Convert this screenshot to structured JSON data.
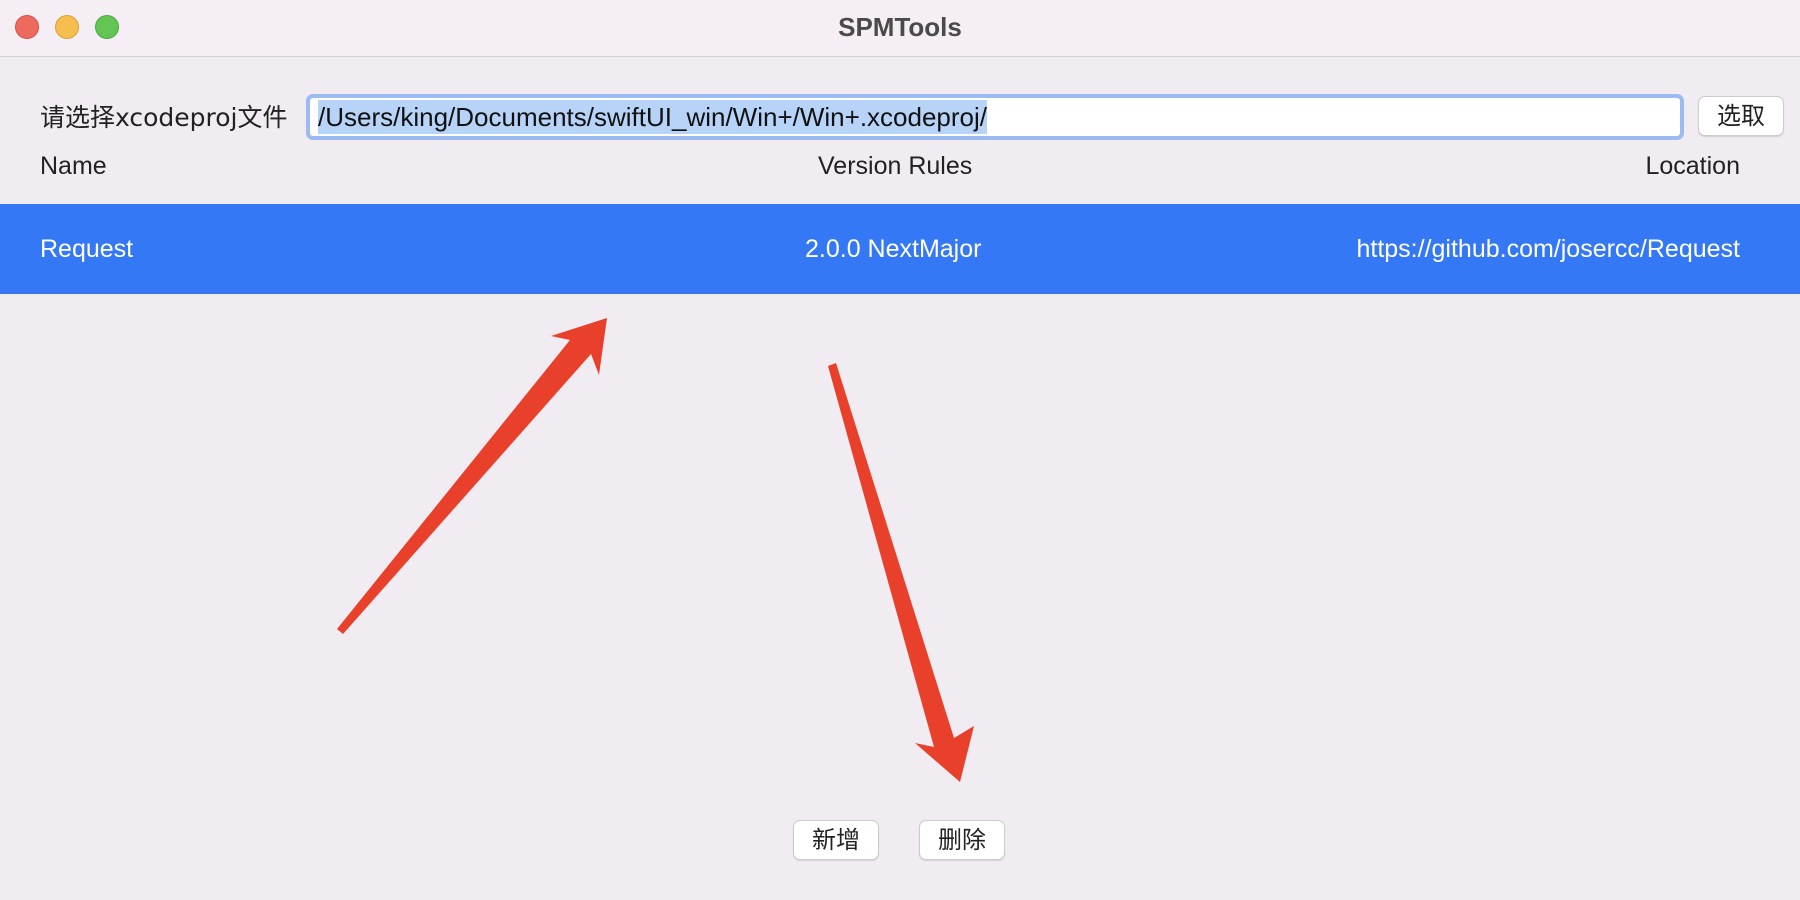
{
  "window": {
    "title": "SPMTools"
  },
  "file_picker": {
    "label": "请选择xcodeproj文件",
    "path_value": "/Users/king/Documents/swiftUI_win/Win+/Win+.xcodeproj/",
    "pick_label": "选取"
  },
  "table": {
    "columns": [
      "Name",
      "Version Rules",
      "Location"
    ],
    "rows": [
      {
        "name": "Request",
        "version": "2.0.0 NextMajor",
        "location": "https://github.com/josercc/Request",
        "selected": true
      }
    ]
  },
  "actions": {
    "add_label": "新增",
    "delete_label": "删除"
  },
  "colors": {
    "selection": "#3478f6",
    "annotation_arrow": "#e8402a",
    "window_background": "#f1ecf2"
  }
}
